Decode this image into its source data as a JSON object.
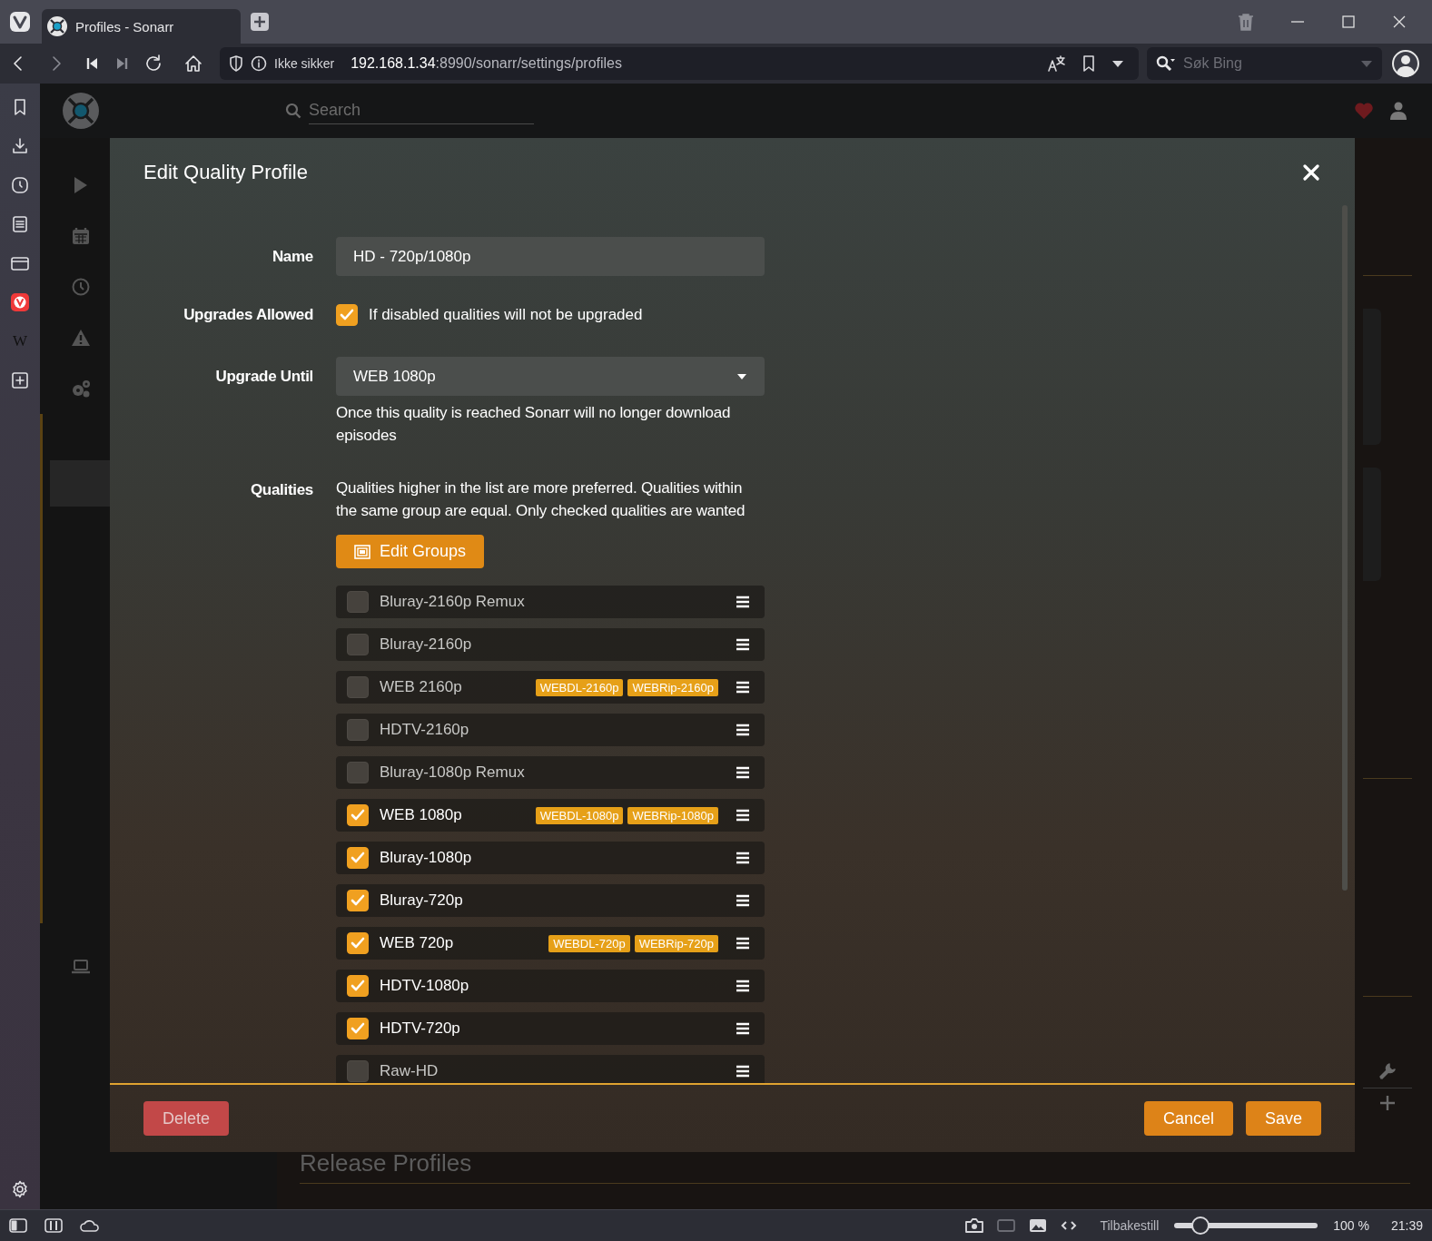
{
  "browser": {
    "tab": {
      "title": "Profiles - Sonarr"
    },
    "address": {
      "security_label": "Ikke sikker",
      "host": "192.168.1.34",
      "path": ":8990/sonarr/settings/profiles"
    },
    "search": {
      "placeholder": "Søk Bing"
    },
    "panel": {
      "web_panel_label": "W"
    }
  },
  "app": {
    "search": {
      "placeholder": "Search"
    },
    "nav": [
      {
        "kind": "main",
        "selected": false
      },
      {
        "kind": "main",
        "selected": false
      },
      {
        "kind": "main",
        "selected": false
      },
      {
        "kind": "main",
        "selected": false
      },
      {
        "kind": "main",
        "selected": false
      },
      {
        "kind": "sub",
        "selected": false
      },
      {
        "kind": "sub",
        "selected": true
      },
      {
        "kind": "sub",
        "selected": false
      },
      {
        "kind": "sub",
        "selected": false
      },
      {
        "kind": "sub",
        "selected": false
      },
      {
        "kind": "sub",
        "selected": false
      },
      {
        "kind": "sub",
        "selected": false
      },
      {
        "kind": "sub",
        "selected": false
      },
      {
        "kind": "sub",
        "selected": false
      },
      {
        "kind": "sub",
        "selected": false
      },
      {
        "kind": "sub",
        "selected": false
      },
      {
        "kind": "main",
        "selected": false
      }
    ],
    "heading": "Release Profiles"
  },
  "modal": {
    "title": "Edit Quality Profile",
    "name": {
      "label": "Name",
      "value": "HD - 720p/1080p"
    },
    "upgrades_allowed": {
      "label": "Upgrades Allowed",
      "checked": true,
      "text": "If disabled qualities will not be upgraded"
    },
    "upgrade_until": {
      "label": "Upgrade Until",
      "value": "WEB 1080p",
      "help": "Once this quality is reached Sonarr will no longer download episodes"
    },
    "qualities": {
      "label": "Qualities",
      "help": "Qualities higher in the list are more preferred. Qualities within the same group are equal. Only checked qualities are wanted",
      "button": "Edit Groups",
      "items": [
        {
          "name": "Bluray-2160p Remux",
          "checked": false
        },
        {
          "name": "Bluray-2160p",
          "checked": false
        },
        {
          "name": "WEB 2160p",
          "checked": false,
          "badges": [
            "WEBDL-2160p",
            "WEBRip-2160p"
          ]
        },
        {
          "name": "HDTV-2160p",
          "checked": false
        },
        {
          "name": "Bluray-1080p Remux",
          "checked": false
        },
        {
          "name": "WEB 1080p",
          "checked": true,
          "badges": [
            "WEBDL-1080p",
            "WEBRip-1080p"
          ]
        },
        {
          "name": "Bluray-1080p",
          "checked": true
        },
        {
          "name": "Bluray-720p",
          "checked": true
        },
        {
          "name": "WEB 720p",
          "checked": true,
          "badges": [
            "WEBDL-720p",
            "WEBRip-720p"
          ]
        },
        {
          "name": "HDTV-1080p",
          "checked": true
        },
        {
          "name": "HDTV-720p",
          "checked": true
        },
        {
          "name": "Raw-HD",
          "checked": false
        }
      ]
    },
    "buttons": {
      "delete": "Delete",
      "cancel": "Cancel",
      "save": "Save"
    }
  },
  "status_bar": {
    "reset": "Tilbakestill",
    "zoom": {
      "level": 0.2,
      "reading": "100 %"
    },
    "time": "21:39"
  }
}
